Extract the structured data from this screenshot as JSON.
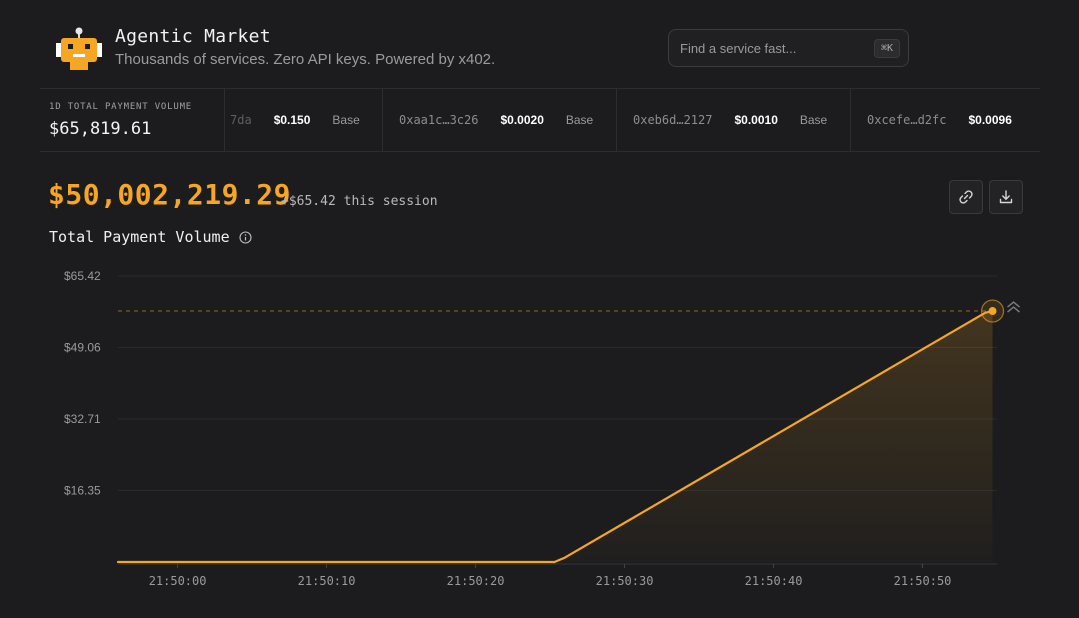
{
  "header": {
    "title": "Agentic Market",
    "tagline": "Thousands of services. Zero API keys. Powered by x402.",
    "logo_icon": "robot-icon"
  },
  "search": {
    "placeholder": "Find a service fast...",
    "shortcut": "⌘K"
  },
  "volume_24h": {
    "label": "1D TOTAL PAYMENT VOLUME",
    "value": "$65,819.61"
  },
  "ticker": [
    {
      "address": "7da",
      "price": "$0.150",
      "network": "Base"
    },
    {
      "address": "0xaa1c…3c26",
      "price": "$0.0020",
      "network": "Base"
    },
    {
      "address": "0xeb6d…2127",
      "price": "$0.0010",
      "network": "Base"
    },
    {
      "address": "0xcefe…d2fc",
      "price": "$0.0096",
      "network": ""
    }
  ],
  "main": {
    "total_value": "$50,002,219.29",
    "session_delta": "+$65.42 this session",
    "chart_title": "Total Payment Volume",
    "link_icon": "link-icon",
    "download_icon": "download-icon",
    "info_icon": "info-icon"
  },
  "colors": {
    "accent": "#f5a623",
    "background": "#1c1c1e"
  },
  "chart_data": {
    "type": "area",
    "title": "Total Payment Volume",
    "xlabel": "",
    "ylabel": "",
    "y_ticks": [
      "$16.35",
      "$32.71",
      "$49.06",
      "$65.42"
    ],
    "y_tick_values": [
      16.35,
      32.71,
      49.06,
      65.42
    ],
    "x_ticks": [
      "21:50:00",
      "21:50:10",
      "21:50:20",
      "21:50:30",
      "21:50:40",
      "21:50:50"
    ],
    "x_tick_values": [
      0,
      10,
      20,
      30,
      40,
      50
    ],
    "ylim": [
      0,
      65.42
    ],
    "xlim": [
      -4,
      55
    ],
    "grid": true,
    "series": [
      {
        "x": [
          -4,
          25.3,
          26,
          54.2,
          54.7
        ],
        "y": [
          0,
          0,
          1,
          57,
          57.4
        ]
      }
    ],
    "reference_line": 57.4,
    "current_point": {
      "x": 54.7,
      "y": 57.4
    }
  }
}
